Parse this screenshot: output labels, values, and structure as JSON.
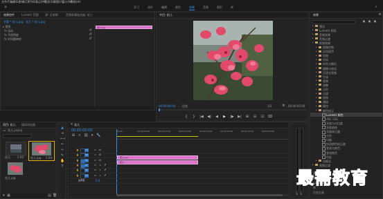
{
  "menu": [
    "文件(F)",
    "编辑(E)",
    "剪辑(C)",
    "序列(S)",
    "标记(M)",
    "图形(G)",
    "视图(V)",
    "窗口(W)",
    "帮助(H)"
  ],
  "workspaces": [
    "学习",
    "组件",
    "编辑",
    "颜色",
    "效果",
    "音频",
    "图形",
    "库"
  ],
  "workspaces_active": 4,
  "source_panel": {
    "tabs": [
      "效果控件",
      "Lumetri 范围",
      "源: 无剪辑",
      "音频剪辑混合器: 花儿"
    ],
    "header_left": "主要 * 花儿.jpg",
    "header_right": "花儿 * 花儿.jpg",
    "sections": [
      "视频",
      "运动",
      "不透明度",
      "时间重映射"
    ],
    "section_symbols": [
      "▸",
      "fx",
      "fx",
      "fx"
    ],
    "clip_label": "花儿.jpg"
  },
  "program_panel": {
    "title": "节目: 花儿",
    "tc_left": "00:00:00:00",
    "fit": "适合",
    "ratio": "1/2",
    "tc_right": "00:00:05:00",
    "transport": [
      "{",
      "}",
      "|◀",
      "◀|",
      "◀",
      "▶",
      "|▶",
      "▶|",
      "⊞",
      "⊟",
      "⊡",
      "⌧"
    ]
  },
  "effects_panel": {
    "title": "效果",
    "items": [
      {
        "label": "预设",
        "indent": 1
      },
      {
        "label": "Lumetri 预设",
        "indent": 1
      },
      {
        "label": "音频效果",
        "indent": 1
      },
      {
        "label": "音频过渡",
        "indent": 1
      },
      {
        "label": "视频效果",
        "indent": 1
      },
      {
        "label": "图像控制",
        "indent": 2
      },
      {
        "label": "实用程序",
        "indent": 2
      },
      {
        "label": "扭曲",
        "indent": 2
      },
      {
        "label": "时间",
        "indent": 2
      },
      {
        "label": "杂色与颗粒",
        "indent": 2
      },
      {
        "label": "模糊与锐化",
        "indent": 2
      },
      {
        "label": "沉浸式视频",
        "indent": 2
      },
      {
        "label": "生成",
        "indent": 2
      },
      {
        "label": "视频",
        "indent": 2
      },
      {
        "label": "调整",
        "indent": 2
      },
      {
        "label": "过时",
        "indent": 2
      },
      {
        "label": "过渡",
        "indent": 2
      },
      {
        "label": "透视",
        "indent": 2
      },
      {
        "label": "通道",
        "indent": 2
      },
      {
        "label": "键控",
        "indent": 2
      },
      {
        "label": "颜色校正",
        "indent": 2
      },
      {
        "label": "Lumetri 颜色",
        "indent": 3,
        "selected": true
      },
      {
        "label": "ASC CDL",
        "indent": 3
      },
      {
        "label": "亮度与对比度",
        "indent": 3
      },
      {
        "label": "亮度曲线",
        "indent": 3
      },
      {
        "label": "亮度校正器",
        "indent": 3
      },
      {
        "label": "分色",
        "indent": 3
      },
      {
        "label": "均衡",
        "indent": 3
      },
      {
        "label": "快速颜色校正器",
        "indent": 3
      },
      {
        "label": "更改为颜色",
        "indent": 3
      },
      {
        "label": "更改颜色",
        "indent": 3
      },
      {
        "label": "色彩",
        "indent": 3
      },
      {
        "label": "风格化",
        "indent": 2
      },
      {
        "label": "视频过渡",
        "indent": 1
      }
    ],
    "footer": "基本图形",
    "footer2": "基本声音",
    "footer3": "Lumetri 颜色",
    "footer4": "库",
    "footer5": "历史记录"
  },
  "project_panel": {
    "tabs": [
      "项目: 花儿",
      "媒体浏览器"
    ],
    "subtitle": "花儿.prproj",
    "items": [
      {
        "name": "花儿",
        "duration": "5:00"
      },
      {
        "name": "花儿.jpg",
        "duration": "5:00"
      },
      {
        "name": "花儿.jpg",
        "duration": ""
      }
    ]
  },
  "timeline": {
    "title": "花儿",
    "timecode": "00:00:00:00",
    "ruler": [
      "00:00",
      "00:00:05:00",
      "00:00:10:00",
      "00:00:15:00",
      "00:00:20:00",
      "00:00:25:00",
      "00:00:30:00",
      "00:00:35:00"
    ],
    "tracks": [
      {
        "id": "V3",
        "type": "v"
      },
      {
        "id": "V2",
        "type": "v"
      },
      {
        "id": "V1",
        "type": "v"
      },
      {
        "id": "A1",
        "type": "a"
      },
      {
        "id": "A2",
        "type": "a"
      },
      {
        "id": "A3",
        "type": "a"
      },
      {
        "id": "主声道",
        "type": "m"
      }
    ],
    "clips": [
      {
        "label": "花儿.jpg"
      },
      {
        "label": "花儿"
      }
    ],
    "master_value": "0.0"
  },
  "watermark": "最需教育",
  "colors": {
    "accent": "#3a8ee6",
    "clip": "#d873c8",
    "panel": "#232323"
  }
}
